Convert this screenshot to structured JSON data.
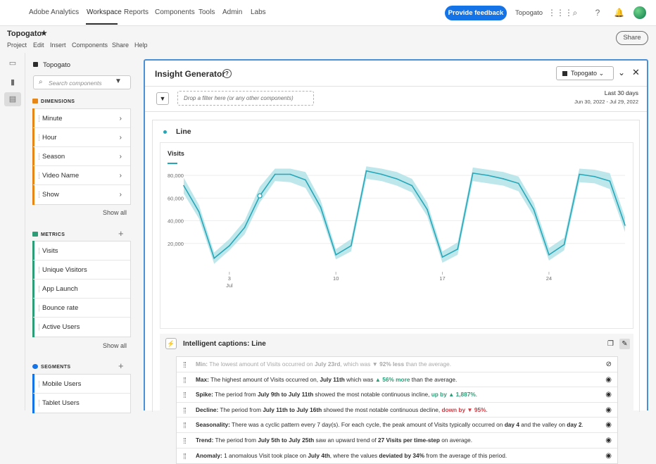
{
  "topnav": {
    "app": "Adobe Analytics",
    "items": [
      "Workspace",
      "Reports",
      "Components",
      "Tools",
      "Admin",
      "Labs"
    ],
    "feedback": "Provide feedback",
    "org": "Topogato"
  },
  "project": {
    "title": "Topogato",
    "menu": [
      "Project",
      "Edit",
      "Insert",
      "Components",
      "Share",
      "Help"
    ],
    "share": "Share"
  },
  "panel": {
    "report_suite": "Topogato",
    "search_placeholder": "Search components",
    "dimensions_label": "DIMENSIONS",
    "dimensions": [
      "Minute",
      "Hour",
      "Season",
      "Video Name",
      "Show"
    ],
    "metrics_label": "METRICS",
    "metrics": [
      "Visits",
      "Unique Visitors",
      "App Launch",
      "Bounce rate",
      "Active Users"
    ],
    "segments_label": "SEGMENTS",
    "segments": [
      "Mobile Users",
      "Tablet Users"
    ],
    "show_all": "Show all",
    "colors": {
      "dimensions": "#e68619",
      "metrics": "#2d9d78",
      "segments": "#1473e6"
    }
  },
  "insight": {
    "title": "Insight Generator",
    "report_suite": "Topogato",
    "dropzone": "Drop a filter here (or any other components)",
    "date_label": "Last 30 days",
    "date_range": "Jun 30, 2022 - Jul 29, 2022",
    "viz_title": "Line",
    "metric": "Visits",
    "captions_title": "Intelligent captions: Line"
  },
  "chart_data": {
    "type": "line",
    "series": [
      {
        "name": "Visits",
        "values": [
          71000,
          48000,
          7000,
          18000,
          34000,
          62000,
          81000,
          81000,
          76000,
          52000,
          10000,
          18000,
          84000,
          81000,
          77000,
          71000,
          50000,
          8000,
          15000,
          82000,
          80000,
          77000,
          73000,
          50000,
          10000,
          19000,
          81000,
          79000,
          75000,
          36000
        ]
      }
    ],
    "band_low": [
      64000,
      42000,
      2000,
      14000,
      28000,
      56000,
      75000,
      74000,
      69000,
      46000,
      6000,
      13000,
      77000,
      75000,
      71000,
      65000,
      44000,
      3000,
      10000,
      75000,
      73000,
      71000,
      66000,
      44000,
      5000,
      14000,
      74000,
      73000,
      68000,
      30000
    ],
    "band_high": [
      78000,
      54000,
      12000,
      24000,
      40000,
      70000,
      86000,
      86000,
      83000,
      58000,
      15000,
      24000,
      88000,
      86000,
      83000,
      77000,
      56000,
      13000,
      21000,
      87000,
      85000,
      83000,
      79000,
      56000,
      16000,
      25000,
      86000,
      85000,
      82000,
      43000
    ],
    "y_ticks": [
      "80,000",
      "60,000",
      "40,000",
      "20,000"
    ],
    "y_tick_values": [
      80000,
      60000,
      40000,
      20000
    ],
    "x_ticks": [
      {
        "label": "3",
        "sub": "Jul",
        "index": 3
      },
      {
        "label": "10",
        "index": 10
      },
      {
        "label": "17",
        "index": 17
      },
      {
        "label": "24",
        "index": 24
      }
    ],
    "ylim": [
      0,
      90000
    ],
    "highlight_index": 5,
    "color": "#26a7b7",
    "band_color": "#a8dfe5"
  },
  "captions": [
    {
      "label": "Min:",
      "pre": " The lowest amount of Visits occurred on ",
      "b1": "July 23rd",
      "mid": ", which was ",
      "delta": "▼ 92% less",
      "post": " than the average.",
      "delta_class": "muted",
      "muted": true
    },
    {
      "label": "Max:",
      "pre": " The highest amount of Visits occurred on, ",
      "b1": "July 11th",
      "mid": " which was ",
      "delta": "▲ 56% more",
      "post": " than the average.",
      "delta_class": "up"
    },
    {
      "label": "Spike:",
      "pre": " The period from ",
      "b1": "July 9th to July 11th",
      "mid": " showed the most notable continuous incline, ",
      "delta": "up by ▲ 1,887%",
      "post": ".",
      "delta_class": "up"
    },
    {
      "label": "Decline:",
      "pre": " The period from ",
      "b1": "July 11th to July 16th",
      "mid": " showed the most notable continuous decline, ",
      "delta": "down by ▼ 95%",
      "post": ".",
      "delta_class": "down"
    },
    {
      "label": "Seasonality:",
      "pre": " There was a cyclic pattern every 7 day(s). For each cycle, the peak amount of Visits typically occurred on ",
      "b1": "day 4",
      "mid": " and the valley on ",
      "delta": "day 2",
      "post": ".",
      "delta_class": "bold"
    },
    {
      "label": "Trend:",
      "pre": " The period from ",
      "b1": "July 5th to July 25th",
      "mid": " saw an upward trend of ",
      "delta": "27 Visits per time-step",
      "post": " on average.",
      "delta_class": "bold"
    },
    {
      "label": "Anomaly:",
      "pre": " 1 anomalous Visit took place on ",
      "b1": "July 4th",
      "mid": ", where the values ",
      "delta": "deviated by 34%",
      "post": " from the average of this period.",
      "delta_class": "bold"
    }
  ]
}
